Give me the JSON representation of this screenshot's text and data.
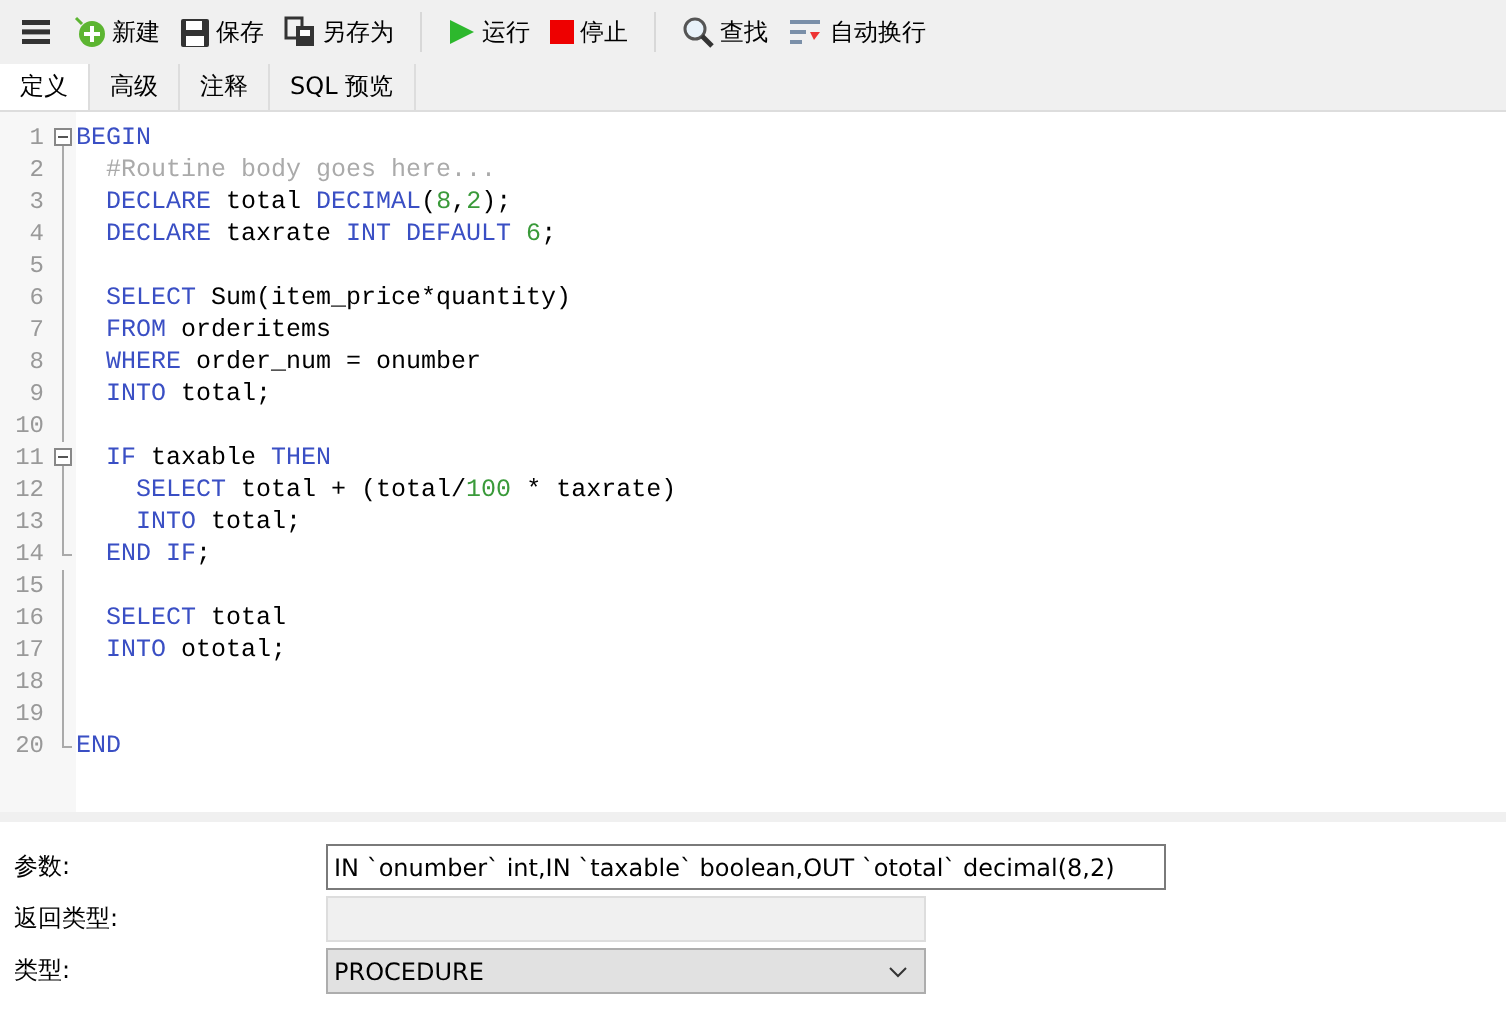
{
  "toolbar": [
    {
      "kind": "menu"
    },
    {
      "kind": "new",
      "label": "新建"
    },
    {
      "kind": "save",
      "label": "保存"
    },
    {
      "kind": "saveas",
      "label": "另存为"
    },
    {
      "kind": "separator"
    },
    {
      "kind": "run",
      "label": "运行"
    },
    {
      "kind": "stop",
      "label": "停止"
    },
    {
      "kind": "separator"
    },
    {
      "kind": "find",
      "label": "查找"
    },
    {
      "kind": "wrap",
      "label": "自动换行"
    }
  ],
  "tabs": [
    {
      "label": "定义",
      "selected": true
    },
    {
      "label": "高级",
      "selected": false
    },
    {
      "label": "注释",
      "selected": false
    },
    {
      "label": "SQL 预览",
      "selected": false
    }
  ],
  "editor": {
    "lines": [
      {
        "num": "1",
        "fold_start": true,
        "tokens": [
          {
            "kind": "kw",
            "text": "BEGIN"
          }
        ]
      },
      {
        "num": "2",
        "tokens": [
          {
            "kind": "cm",
            "text": "  #Routine body goes here..."
          }
        ]
      },
      {
        "num": "3",
        "tokens": [
          {
            "kind": "kw",
            "text": "  DECLARE"
          },
          {
            "kind": "tx",
            "text": " total "
          },
          {
            "kind": "kw",
            "text": "DECIMAL"
          },
          {
            "kind": "tx",
            "text": "("
          },
          {
            "kind": "num",
            "text": "8"
          },
          {
            "kind": "tx",
            "text": ","
          },
          {
            "kind": "num",
            "text": "2"
          },
          {
            "kind": "tx",
            "text": ");"
          }
        ]
      },
      {
        "num": "4",
        "tokens": [
          {
            "kind": "kw",
            "text": "  DECLARE"
          },
          {
            "kind": "tx",
            "text": " taxrate "
          },
          {
            "kind": "kw",
            "text": "INT DEFAULT "
          },
          {
            "kind": "num",
            "text": "6"
          },
          {
            "kind": "tx",
            "text": ";"
          }
        ]
      },
      {
        "num": "5"
      },
      {
        "num": "6",
        "tokens": [
          {
            "kind": "kw",
            "text": "  SELECT"
          },
          {
            "kind": "tx",
            "text": " Sum(item_price*quantity)"
          }
        ]
      },
      {
        "num": "7",
        "tokens": [
          {
            "kind": "kw",
            "text": "  FROM"
          },
          {
            "kind": "tx",
            "text": " orderitems"
          }
        ]
      },
      {
        "num": "8",
        "tokens": [
          {
            "kind": "kw",
            "text": "  WHERE"
          },
          {
            "kind": "tx",
            "text": " order_num = onumber"
          }
        ]
      },
      {
        "num": "9",
        "tokens": [
          {
            "kind": "kw",
            "text": "  INTO"
          },
          {
            "kind": "tx",
            "text": " total;"
          }
        ]
      },
      {
        "num": "10"
      },
      {
        "num": "11",
        "fold_start": true,
        "tokens": [
          {
            "kind": "kw",
            "text": "  IF"
          },
          {
            "kind": "tx",
            "text": " taxable "
          },
          {
            "kind": "kw",
            "text": "THEN"
          }
        ]
      },
      {
        "num": "12",
        "tokens": [
          {
            "kind": "kw",
            "text": "    SELECT"
          },
          {
            "kind": "tx",
            "text": " total + (total/"
          },
          {
            "kind": "num",
            "text": "100"
          },
          {
            "kind": "tx",
            "text": " * taxrate)"
          }
        ]
      },
      {
        "num": "13",
        "tokens": [
          {
            "kind": "kw",
            "text": "    INTO"
          },
          {
            "kind": "tx",
            "text": " total;"
          }
        ]
      },
      {
        "num": "14",
        "fold_end": true,
        "tokens": [
          {
            "kind": "kw",
            "text": "  END IF"
          },
          {
            "kind": "tx",
            "text": ";"
          }
        ]
      },
      {
        "num": "15"
      },
      {
        "num": "16",
        "tokens": [
          {
            "kind": "kw",
            "text": "  SELECT"
          },
          {
            "kind": "tx",
            "text": " total"
          }
        ]
      },
      {
        "num": "17",
        "tokens": [
          {
            "kind": "kw",
            "text": "  INTO"
          },
          {
            "kind": "tx",
            "text": " ototal;"
          }
        ]
      },
      {
        "num": "18"
      },
      {
        "num": "19"
      },
      {
        "num": "20",
        "fold_end": true,
        "tokens": [
          {
            "kind": "kw",
            "text": "END"
          }
        ]
      }
    ]
  },
  "form": [
    {
      "kind": "text",
      "label": "参数:",
      "value": "IN `onumber` int,IN `taxable` boolean,OUT `ototal` decimal(8,2)"
    },
    {
      "kind": "disabled",
      "label": "返回类型:"
    },
    {
      "kind": "select",
      "label": "类型:",
      "value": "PROCEDURE"
    }
  ]
}
